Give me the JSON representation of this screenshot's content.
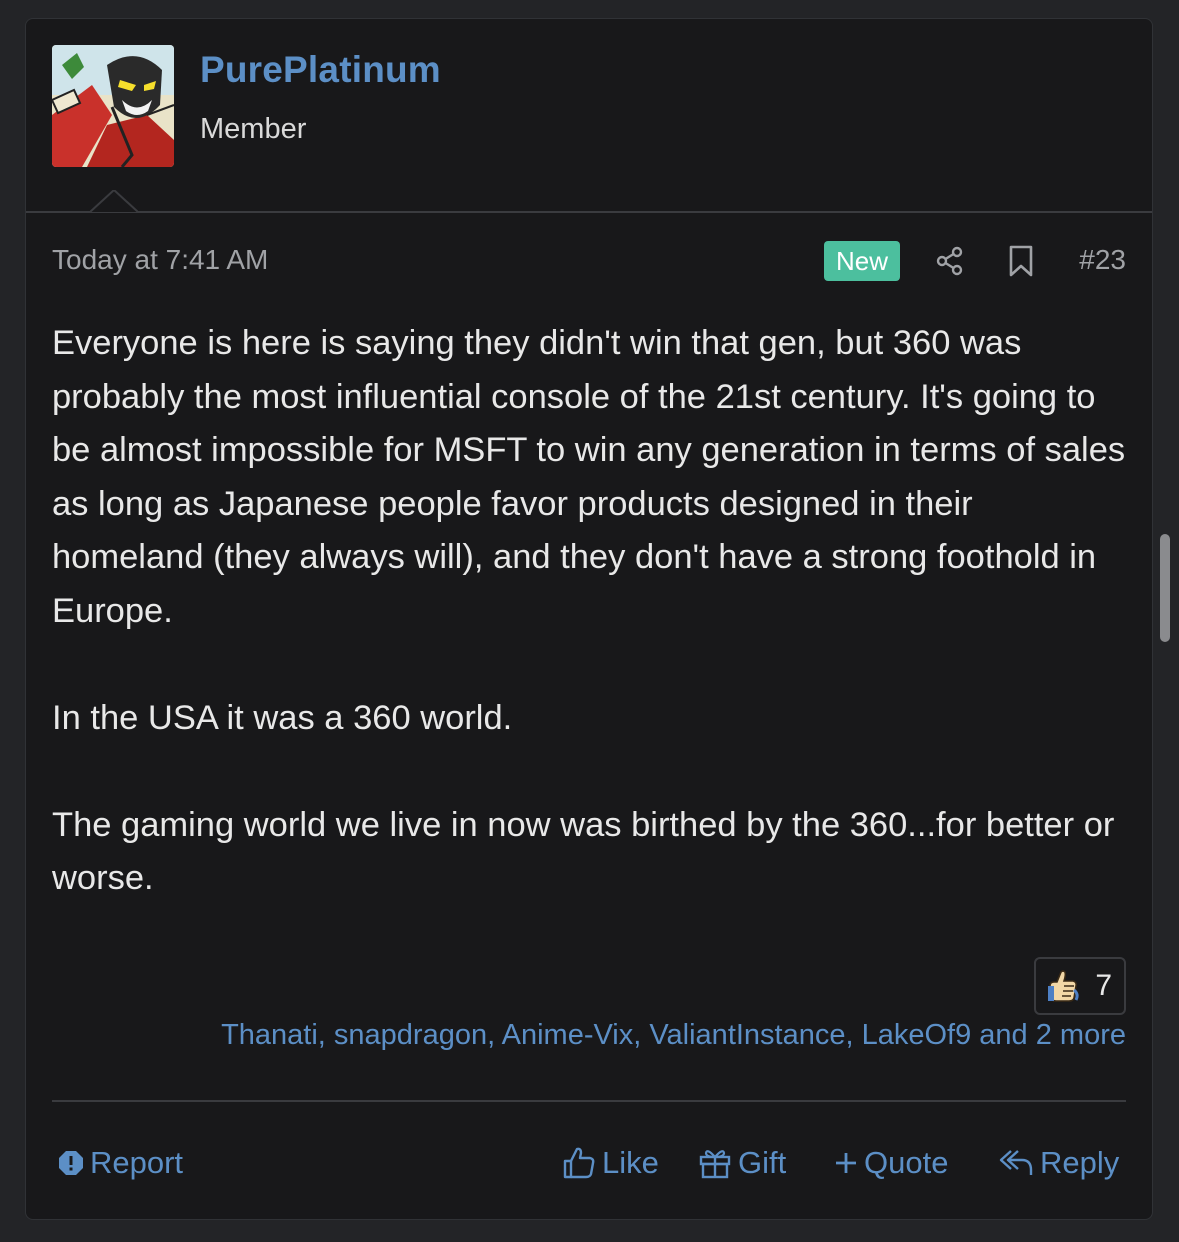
{
  "user": {
    "name": "PurePlatinum",
    "title": "Member",
    "avatar_icon": "comic-hero-avatar"
  },
  "meta": {
    "timestamp": "Today at 7:41 AM",
    "badge": "New",
    "post_number": "#23",
    "share_icon": "share-icon",
    "bookmark_icon": "bookmark-icon"
  },
  "message": {
    "paragraphs": [
      "Everyone is here is saying they didn't win that gen, but 360 was probably the most influential console of the 21st century. It's going to be almost impossible for MSFT to win any generation in terms of sales as long as Japanese people favor products designed in their homeland (they always will), and they don't have a strong foothold in Europe.",
      "In the USA it was a 360 world.",
      "The gaming world we live in now was birthed by the 360...for better or worse."
    ]
  },
  "reactions": {
    "icon": "thumbs-up-icon",
    "count": "7",
    "users_text": "Thanati, snapdragon, Anime-Vix, ValiantInstance, LakeOf9 and 2 more"
  },
  "actions": {
    "report": "Report",
    "like": "Like",
    "gift": "Gift",
    "quote": "Quote",
    "reply": "Reply"
  },
  "colors": {
    "link": "#5c8fc6",
    "badge_new": "#4cbf9e",
    "background": "#18181a",
    "text": "#e8e8e8"
  }
}
